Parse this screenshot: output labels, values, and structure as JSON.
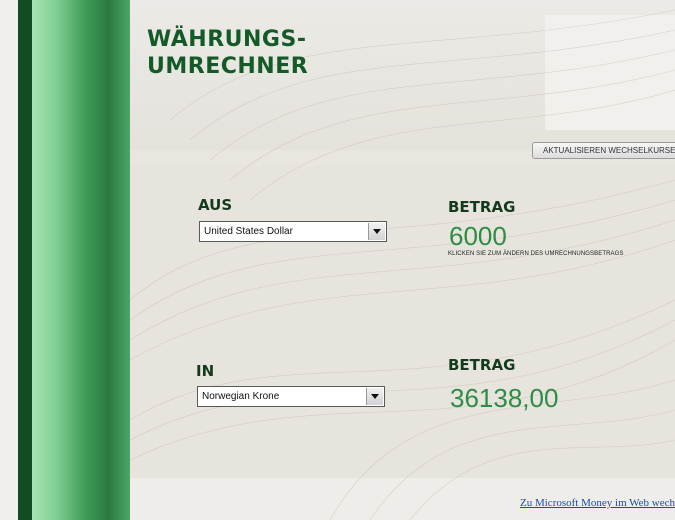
{
  "header": {
    "title": "WÄHRUNGS-\nUMRECHNER",
    "refresh_button": "AKTUALISIEREN WECHSELKURSE"
  },
  "from": {
    "label": "AUS",
    "currency": "United States Dollar",
    "amount_label": "BETRAG",
    "amount": "6000",
    "hint": "KLICKEN SIE ZUM ÄNDERN DES UMRECHNUNGSBETRAGS"
  },
  "to": {
    "label": "IN",
    "currency": "Norwegian Krone",
    "amount_label": "BETRAG",
    "amount": "36138,00"
  },
  "footer": {
    "link": "Zu Microsoft Money im Web wechseln"
  },
  "colors": {
    "accent_green": "#2e8d45",
    "title_green": "#135a27",
    "stripe_dark": "#124c22"
  }
}
